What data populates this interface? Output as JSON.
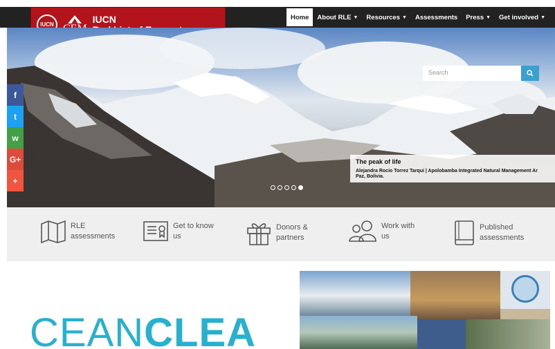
{
  "logo": {
    "iucn_badge": "IUCN",
    "cem": "CEM",
    "title_line1": "IUCN",
    "title_line2": "Red List of Ecosystems"
  },
  "nav": {
    "items": [
      {
        "label": "Home",
        "active": true,
        "dropdown": false
      },
      {
        "label": "About RLE",
        "active": false,
        "dropdown": true
      },
      {
        "label": "Resources",
        "active": false,
        "dropdown": true
      },
      {
        "label": "Assessments",
        "active": false,
        "dropdown": false
      },
      {
        "label": "Press",
        "active": false,
        "dropdown": true
      },
      {
        "label": "Get involved",
        "active": false,
        "dropdown": true
      }
    ]
  },
  "search": {
    "placeholder": "Search",
    "icon": "search-icon"
  },
  "hero": {
    "caption_title": "The peak of life",
    "caption_text_line1": "Alejandra Rocio Torrez Tarqui | Apolobamba Integrated Natural Management Ar",
    "caption_text_line2": "Paz, Bolivia.",
    "slides": 5,
    "active_slide": 5
  },
  "social": [
    {
      "name": "facebook",
      "glyph": "f",
      "color": "#3b5998"
    },
    {
      "name": "twitter",
      "glyph": "t",
      "color": "#1da1f2"
    },
    {
      "name": "whatsapp",
      "glyph": "w",
      "color": "#43a047"
    },
    {
      "name": "google-plus",
      "glyph": "G+",
      "color": "#dd4b39"
    },
    {
      "name": "share",
      "glyph": "+",
      "color": "#f0553f"
    }
  ],
  "features": [
    {
      "line1": "RLE",
      "line2": "assessments",
      "icon": "map-icon"
    },
    {
      "line1": "Get to know",
      "line2": "us",
      "icon": "certificate-icon"
    },
    {
      "line1": "Donors &",
      "line2": "partners",
      "icon": "gift-icon"
    },
    {
      "line1": "Work with",
      "line2": "us",
      "icon": "people-icon"
    },
    {
      "line1": "Published",
      "line2": "assessments",
      "icon": "book-icon"
    }
  ],
  "banner": {
    "text_light": "CEAN",
    "text_bold": "CLEA"
  },
  "colors": {
    "brand_red": "#b3141b",
    "nav_bg": "#222222",
    "accent_blue": "#3aa0d0",
    "ocean_teal": "#27b1cf"
  }
}
